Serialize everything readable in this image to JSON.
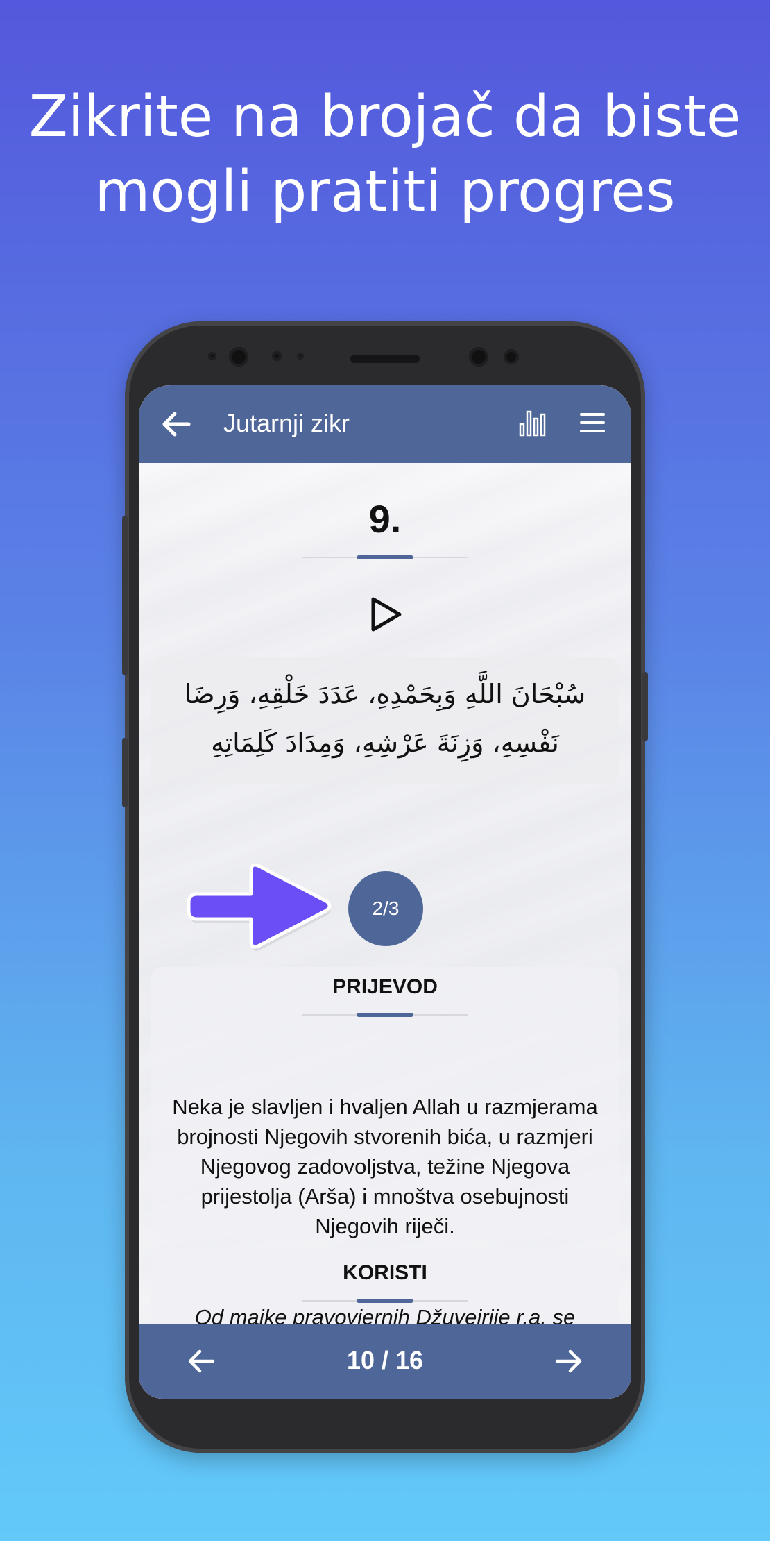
{
  "headline": {
    "line1": "Zikrite na brojač da biste",
    "line2": "mogli pratiti progres"
  },
  "appbar": {
    "title": "Jutarnji zikr",
    "back_icon": "arrow-left-icon",
    "stats_icon": "bar-chart-icon",
    "menu_icon": "hamburger-menu-icon"
  },
  "dhikr": {
    "number": "9.",
    "play_icon": "play-icon",
    "arabic_line1": "سُبْحَانَ اللَّهِ وَبِحَمْدِهِ، عَدَدَ خَلْقِهِ، وَرِضَا",
    "arabic_line2": "نَفْسِهِ، وَزِنَةَ عَرْشِهِ، وَمِدَادَ كَلِمَاتِهِ",
    "counter": "2/3"
  },
  "translation": {
    "title": "PRIJEVOD",
    "text": "Neka je slavljen i hvaljen Allah u razmjerama brojnosti Njegovih stvorenih bića, u razmjeri Njegovog zadovoljstva, težine Njegova prijestolja (Arša) i mnoštva osebujnosti Njegovih riječi."
  },
  "benefits": {
    "title": "KORISTI",
    "text": "Od majke pravovjernih Džuvejrije r.a. se prenosi da je Allahov Poslanik sallallahu alejhi ve sellem izašao od nje rano"
  },
  "bottombar": {
    "page": "10 / 16",
    "prev_icon": "arrow-left-icon",
    "next_icon": "arrow-right-icon"
  },
  "colors": {
    "accent": "#4f6698",
    "pointer": "#6b4ef6",
    "background_top": "#5458dc",
    "background_bottom": "#62c9fa"
  }
}
